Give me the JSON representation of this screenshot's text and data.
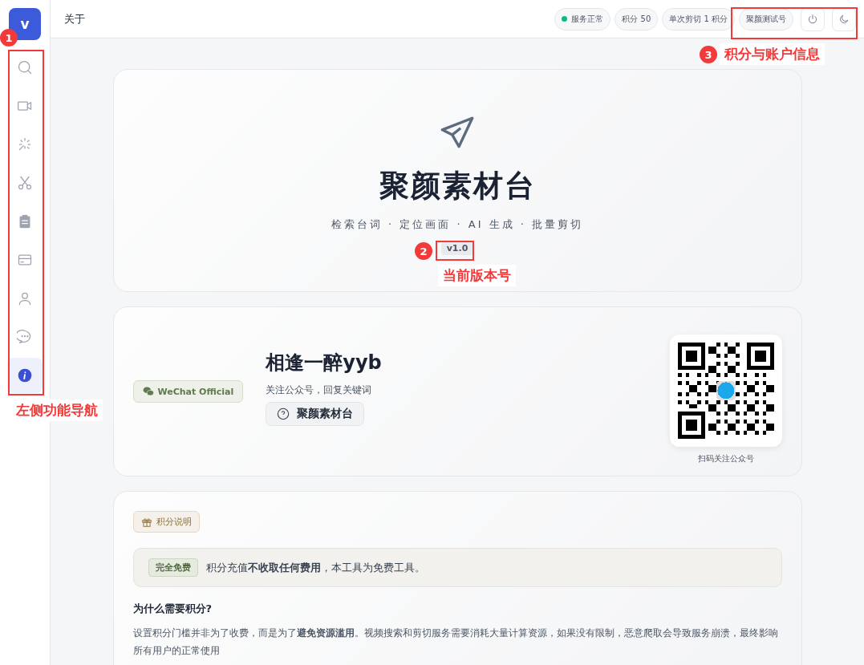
{
  "logo": "v",
  "sidebar": {
    "items": [
      {
        "kind": "search",
        "selected": false
      },
      {
        "kind": "video",
        "selected": false
      },
      {
        "kind": "sparkle",
        "selected": false
      },
      {
        "kind": "scissors",
        "selected": false
      },
      {
        "kind": "clipboard",
        "selected": false
      },
      {
        "kind": "card",
        "selected": false
      },
      {
        "kind": "user",
        "selected": false
      },
      {
        "kind": "chat",
        "selected": false
      },
      {
        "kind": "info",
        "selected": true
      }
    ]
  },
  "header": {
    "title": "关于",
    "status": {
      "label": "服务正常",
      "color": "#10b981"
    },
    "chips": [
      "积分 50",
      "单次剪切 1 积分",
      "聚颜测试号"
    ]
  },
  "hero": {
    "title": "聚颜素材台",
    "tagline": "检索台词 · 定位画面 · AI 生成 · 批量剪切",
    "version": "v1.0"
  },
  "wechat": {
    "badge": "WeChat Official",
    "name": "相逢一醉yyb",
    "hint": "关注公众号，回复关键词",
    "keyword": "聚颜素材台",
    "qr_caption": "扫码关注公众号"
  },
  "points": {
    "tag": "积分说明",
    "free_badge": "完全免费",
    "free_text": "积分充值**不收取任何费用**，本工具为免费工具。",
    "question": "为什么需要积分?",
    "answer": "设置积分门槛并非为了收费，而是为了**避免资源滥用**。视频搜索和剪切服务需要消耗大量计算资源，如果没有限制，恶意爬取会导致服务崩溃，最终影响所有用户的正常使用"
  },
  "annotations": [
    {
      "number": "1",
      "label": "左侧功能导航"
    },
    {
      "number": "2",
      "label": "当前版本号"
    },
    {
      "number": "3",
      "label": "积分与账户信息"
    }
  ]
}
